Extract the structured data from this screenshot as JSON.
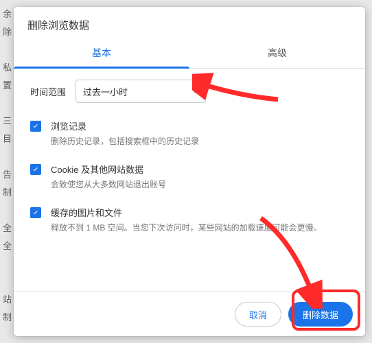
{
  "dialog": {
    "title": "删除浏览数据",
    "tabs": {
      "basic": "基本",
      "advanced": "高级"
    },
    "time": {
      "label": "时间范围",
      "selected": "过去一小时"
    },
    "options": [
      {
        "title": "浏览记录",
        "desc": "删除历史记录，包括搜索框中的历史记录",
        "checked": true
      },
      {
        "title": "Cookie 及其他网站数据",
        "desc": "会致使您从大多数网站退出账号",
        "checked": true
      },
      {
        "title": "缓存的图片和文件",
        "desc": "释放不到 1 MB 空间。当您下次访问时，某些网站的加载速度可能会更慢。",
        "checked": true
      }
    ],
    "buttons": {
      "cancel": "取消",
      "confirm": "删除数据"
    }
  },
  "background_text": [
    "余",
    "除",
    "",
    "私",
    "置",
    "",
    "三",
    "目",
    "",
    "告",
    "制",
    "",
    "全",
    "全",
    "",
    "",
    "站",
    "制"
  ]
}
